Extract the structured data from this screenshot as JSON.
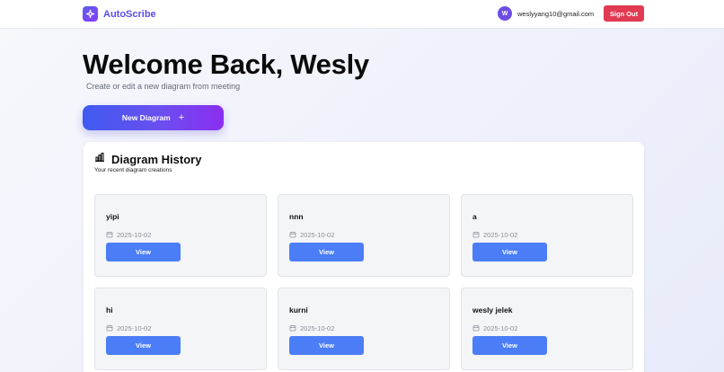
{
  "header": {
    "brand": "AutoScribe",
    "brand_icon": "sparkle-icon",
    "avatar_initial": "W",
    "email": "weslyyang10@gmail.com",
    "sign_out_label": "Sign Out"
  },
  "main": {
    "welcome": "Welcome Back, Wesly",
    "subtitle": "Create or edit a new diagram from meeting",
    "new_diagram_label": "New Diagram",
    "new_diagram_icon": "+"
  },
  "history": {
    "title": "Diagram History",
    "icon": "bar-chart-icon",
    "subtitle": "Your recent diagram creations",
    "view_label": "View",
    "items": [
      {
        "title": "yipi",
        "date": "2025-10-02"
      },
      {
        "title": "nnn",
        "date": "2025-10-02"
      },
      {
        "title": "a",
        "date": "2025-10-02"
      },
      {
        "title": "hi",
        "date": "2025-10-02"
      },
      {
        "title": "kurni",
        "date": "2025-10-02"
      },
      {
        "title": "wesly jelek",
        "date": "2025-10-02"
      }
    ]
  },
  "colors": {
    "accent": "#5b4ee8",
    "sign_out": "#e23a52",
    "view_button": "#4b7ef6"
  }
}
